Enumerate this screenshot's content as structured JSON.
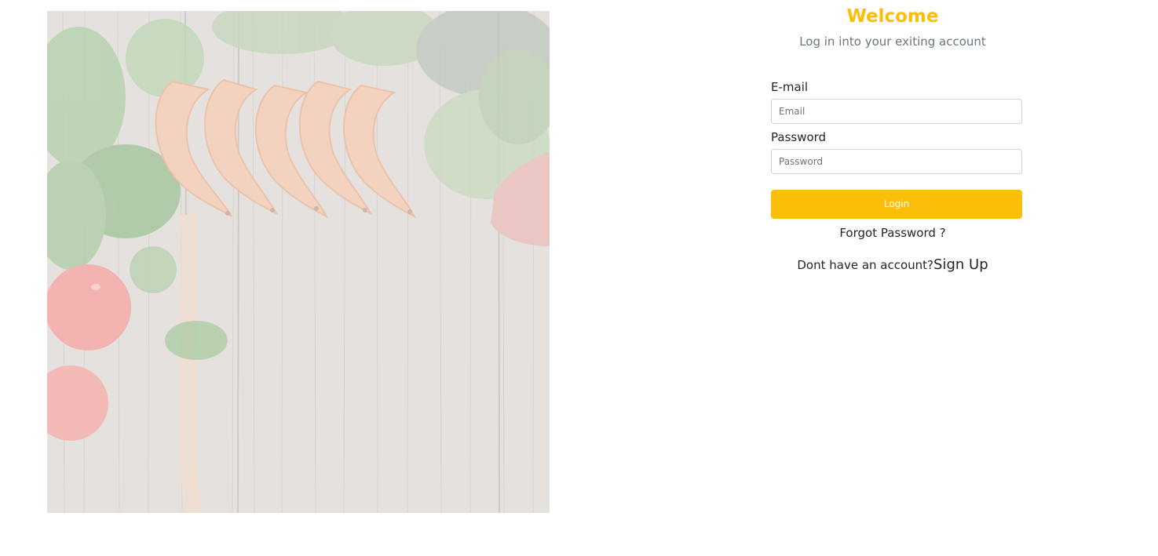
{
  "login": {
    "title": "Welcome",
    "subtitle": "Log in into your exiting account",
    "email_label": "E-mail",
    "email_placeholder": "Email",
    "email_value": "",
    "password_label": "Password",
    "password_placeholder": "Password",
    "password_value": "",
    "login_button": "Login",
    "forgot_password": "Forgot Password ?",
    "no_account_text": "Dont have an account?",
    "signup_link": "Sign Up"
  },
  "colors": {
    "accent": "#fbbf0a",
    "text": "#212529",
    "muted": "#6c757d",
    "input_border": "#ced4da"
  },
  "hero_image": {
    "subject": "food-photo-shrimp-herbs-tomatoes-on-wood"
  }
}
